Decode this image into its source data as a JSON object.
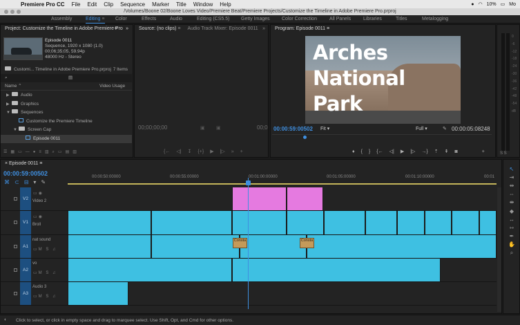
{
  "menubar": {
    "apple_glyph": "",
    "app": "Premiere Pro CC",
    "items": [
      "File",
      "Edit",
      "Clip",
      "Sequence",
      "Marker",
      "Title",
      "Window",
      "Help"
    ],
    "battery": "10%",
    "clock": "Mo"
  },
  "titlebar": {
    "path": "/Volumes/Boone 02/Boone Loves Video/Premiere Beat/Premiere Projects/Customize the Timeline in Adobe Premiere Pro.prproj"
  },
  "workspaces": {
    "items": [
      "Assembly",
      "Editing",
      "Color",
      "Effects",
      "Audio",
      "Editing (CS5.5)",
      "Getty Images",
      "Color Correction",
      "All Panels",
      "Libraries",
      "Titles",
      "Metalogging"
    ],
    "active": "Editing"
  },
  "project": {
    "title": "Project: Customize the Timeline in Adobe Premiere Pro",
    "clip_name": "Episode 0011",
    "clip_info": [
      "Sequence, 1920 x 1080 (1.0)",
      "00;06;35;05, 59.94p",
      "48000 Hz - Stereo"
    ],
    "project_file": "Customi... Timeline in Adobe Premiere Pro.prproj",
    "item_count": "7 Items",
    "col_name": "Name",
    "col_usage": "Video Usage",
    "tree": [
      {
        "label": "Audio",
        "type": "folder",
        "indent": 0,
        "expanded": false
      },
      {
        "label": "Graphics",
        "type": "folder",
        "indent": 0,
        "expanded": false
      },
      {
        "label": "Sequences",
        "type": "folder",
        "indent": 0,
        "expanded": true
      },
      {
        "label": "Customize the Premiere Timeline",
        "type": "sequence",
        "indent": 1
      },
      {
        "label": "Screen Cap",
        "type": "folder",
        "indent": 1,
        "expanded": true
      },
      {
        "label": "Episode 0011",
        "type": "sequence",
        "indent": 2,
        "selected": true
      }
    ]
  },
  "source": {
    "title": "Source: (no clips)",
    "tab2": "Audio Track Mixer: Episode 0011",
    "timecode": "00;00;00;00",
    "timecode_right": "00;0"
  },
  "program": {
    "title": "Program: Episode 0011",
    "video_title": [
      "Arches",
      "National",
      "Park"
    ],
    "timecode": "00:00:59:00502",
    "fit": "Fit",
    "quality": "Full",
    "duration": "00:00:05:08248"
  },
  "meters": {
    "scale": [
      "0",
      "-6",
      "-12",
      "-18",
      "-24",
      "-30",
      "-36",
      "-42",
      "-48",
      "-54",
      "dB"
    ],
    "solo": "S  S"
  },
  "timeline": {
    "title": "Episode 0011",
    "timecode": "00:00:59:00502",
    "ruler": [
      "00:00:50:00000",
      "00:00:55:00000",
      "00:01:00:00000",
      "00:01:05:00000",
      "00:01:10:00000",
      "00:01"
    ],
    "tracks": [
      {
        "id": "V2",
        "name": "Video 2"
      },
      {
        "id": "V1",
        "name": "Broll"
      },
      {
        "id": "A1",
        "name": "nat sound"
      },
      {
        "id": "A2",
        "name": "vo"
      },
      {
        "id": "A3",
        "name": "Audio 3"
      }
    ],
    "fx_label": "Consta"
  },
  "status": {
    "text": "Click to select, or click in empty space and drag to marquee select. Use Shift, Opt, and Cmd for other options."
  },
  "colors": {
    "accent": "#3f8fe0",
    "video_clip": "#3ec0e2",
    "graphic_clip": "#e57ae0",
    "track_tag": "#1d4f80",
    "transition": "#c49a5a"
  }
}
